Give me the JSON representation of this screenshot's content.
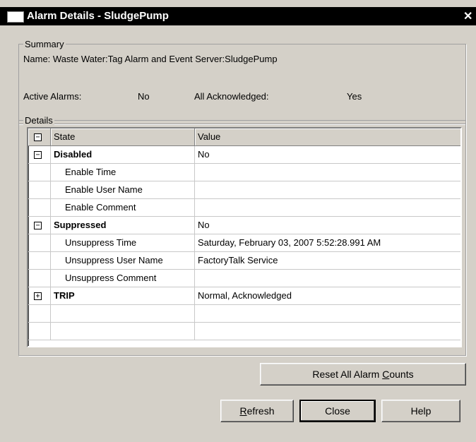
{
  "window": {
    "title": "Alarm Details - SludgePump"
  },
  "summary": {
    "legend": "Summary",
    "name_line": "Name: Waste Water:Tag Alarm and Event Server:SludgePump",
    "active_alarms_label": "Active Alarms:",
    "active_alarms_value": "No",
    "all_ack_label": "All Acknowledged:",
    "all_ack_value": "Yes"
  },
  "details": {
    "legend": "Details",
    "columns": [
      "State",
      "Value"
    ],
    "rows": [
      {
        "toggle": "−",
        "state": "Disabled",
        "value": "No"
      },
      {
        "toggle": "",
        "state": "Enable Time",
        "value": ""
      },
      {
        "toggle": "",
        "state": "Enable User Name",
        "value": ""
      },
      {
        "toggle": "",
        "state": "Enable Comment",
        "value": ""
      },
      {
        "toggle": "−",
        "state": "Suppressed",
        "value": "No"
      },
      {
        "toggle": "",
        "state": "Unsuppress Time",
        "value": "Saturday, February 03, 2007 5:52:28.991 AM"
      },
      {
        "toggle": "",
        "state": "Unsuppress User Name",
        "value": "FactoryTalk Service"
      },
      {
        "toggle": "",
        "state": "Unsuppress Comment",
        "value": ""
      },
      {
        "toggle": "+",
        "state": "TRIP",
        "value": "Normal, Acknowledged"
      }
    ]
  },
  "buttons": {
    "reset": {
      "prefix": "Reset All Alarm ",
      "mnemonic": "C",
      "suffix": "ounts"
    },
    "refresh": {
      "prefix": "",
      "mnemonic": "R",
      "suffix": "efresh"
    },
    "close": "Close",
    "help": "Help"
  }
}
